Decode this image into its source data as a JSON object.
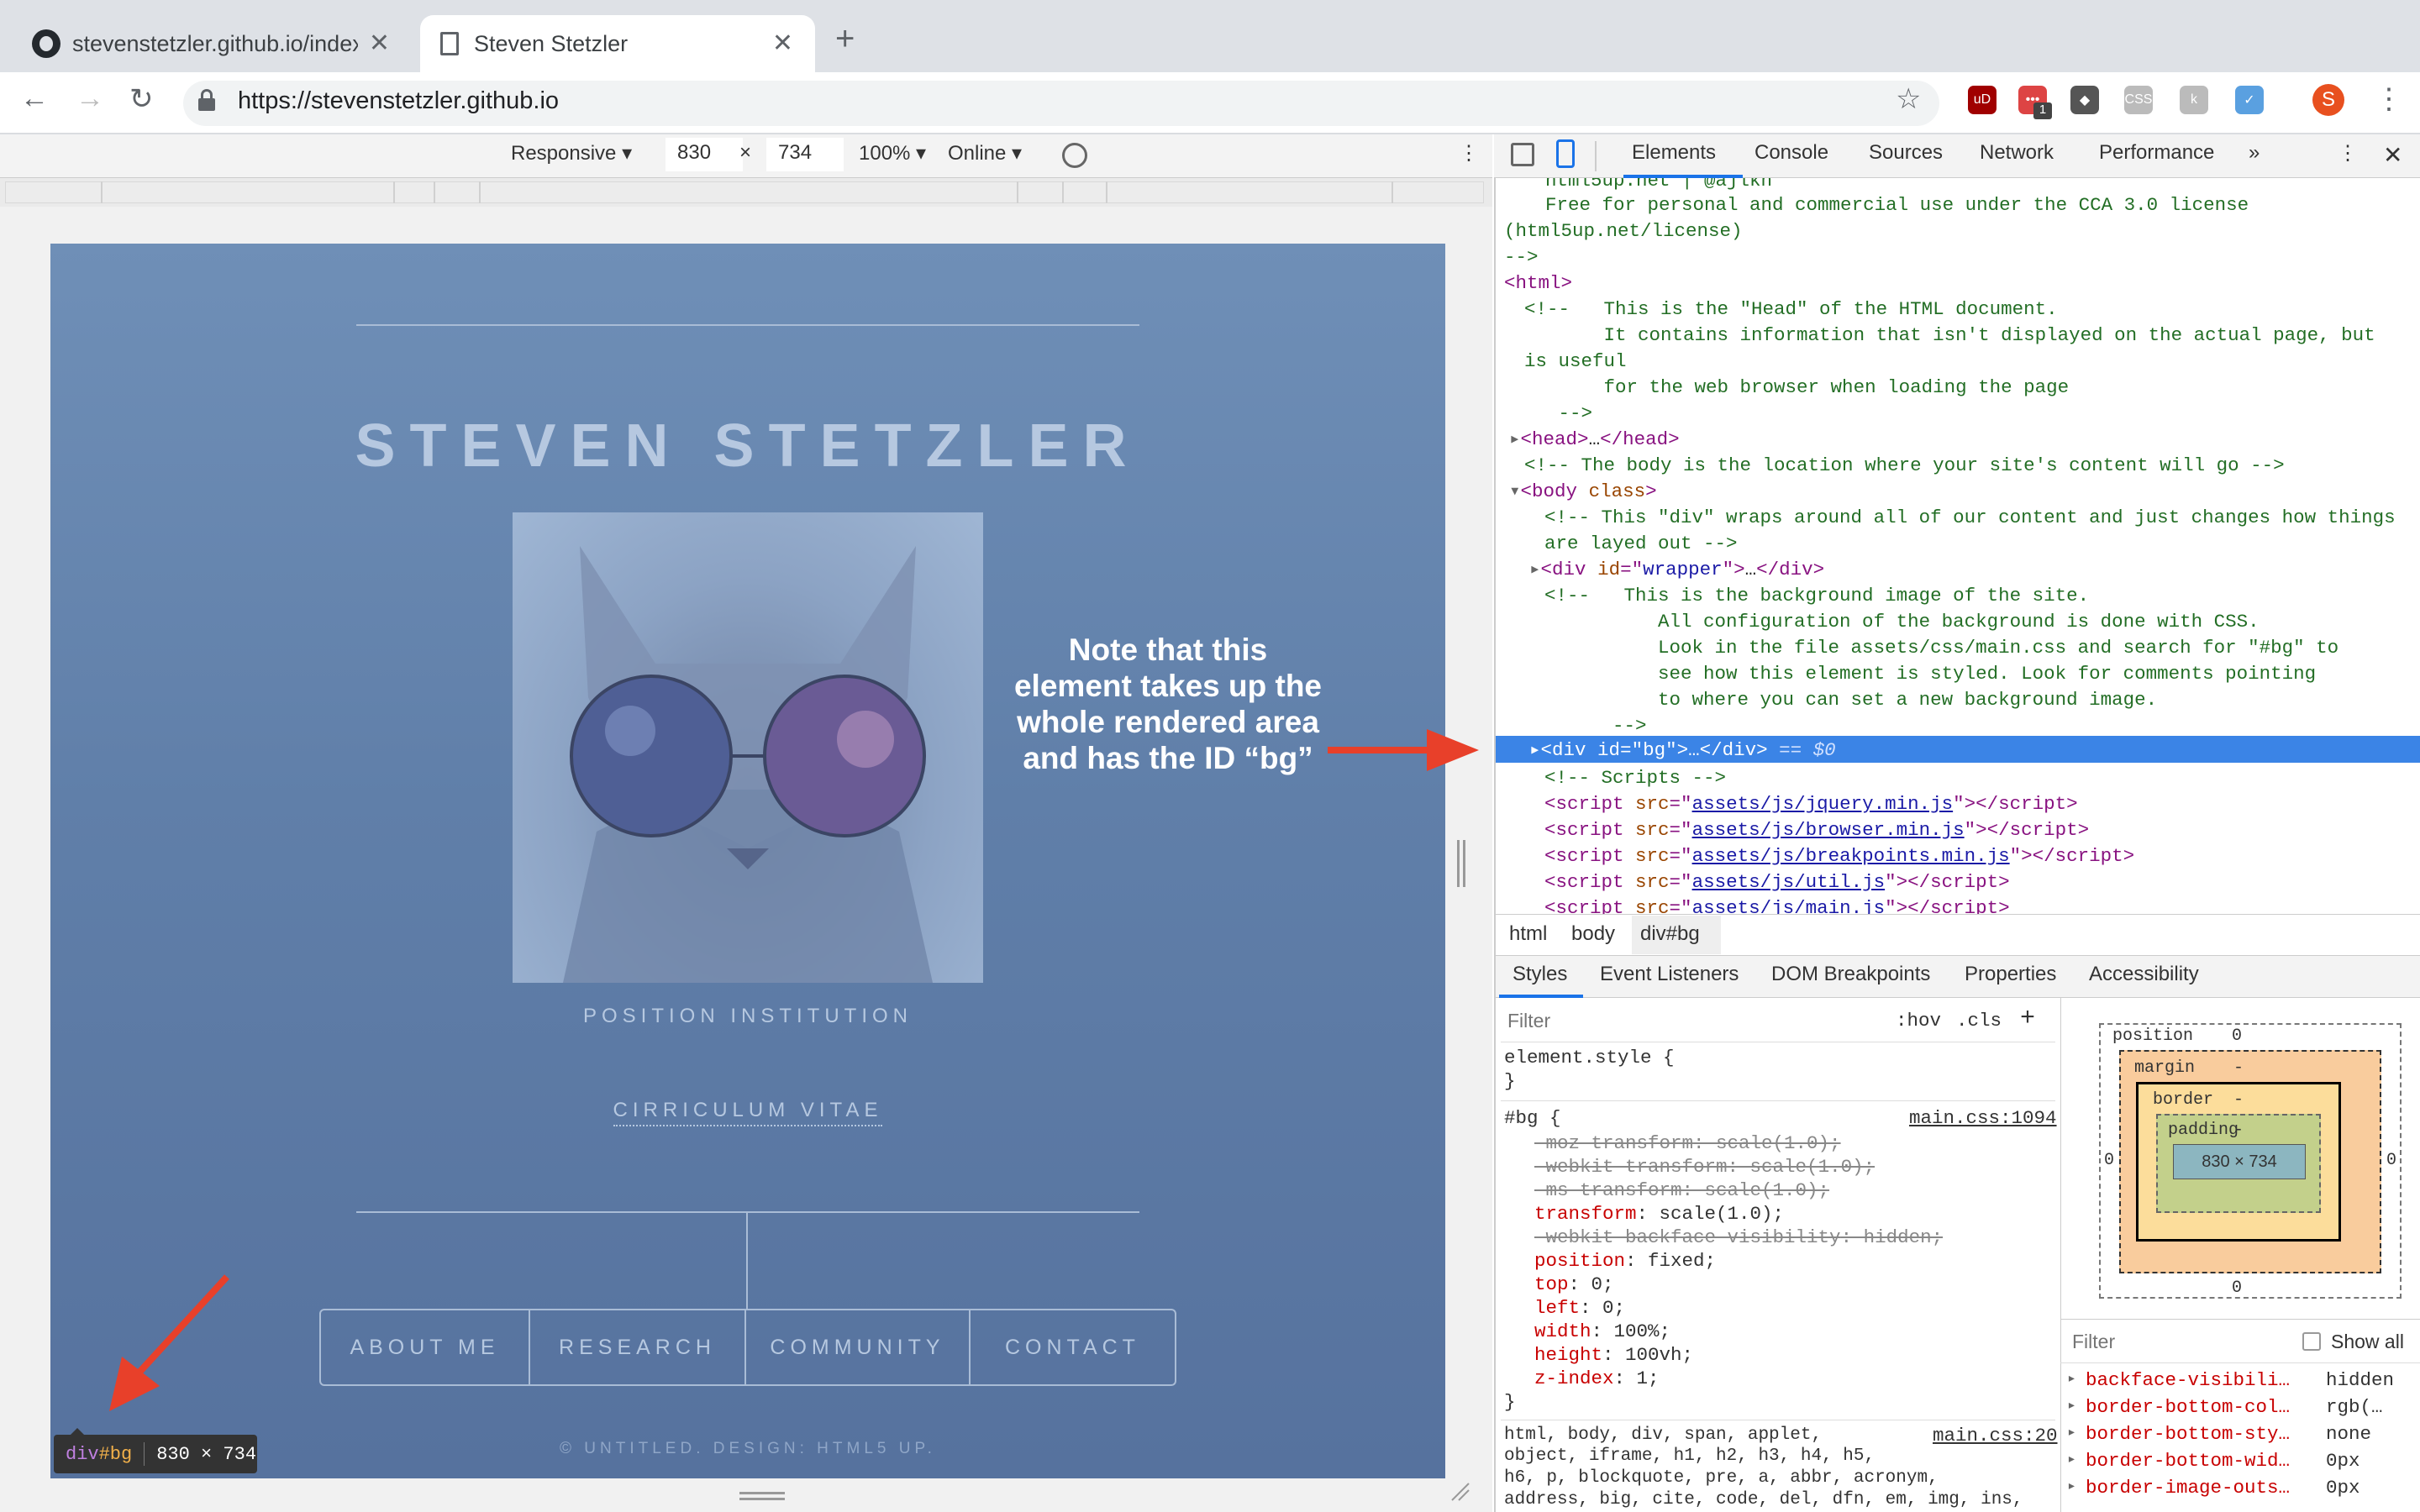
{
  "tabs": [
    {
      "title": "stevenstetzler.github.io/index.h",
      "active": false
    },
    {
      "title": "Steven Stetzler",
      "active": true
    }
  ],
  "address": {
    "url": "https://stevenstetzler.github.io"
  },
  "extensions": [
    {
      "name": "ublock-icon",
      "color": "#a00000",
      "label": "uD"
    },
    {
      "name": "ext-red-icon",
      "color": "#d44",
      "label": "•••",
      "badge": "1"
    },
    {
      "name": "ext-shield-icon",
      "color": "#555",
      "label": "◆"
    },
    {
      "name": "ext-css-icon",
      "color": "#bbb",
      "label": "CSS"
    },
    {
      "name": "ext-grey-icon",
      "color": "#bbb",
      "label": "k"
    },
    {
      "name": "ext-blue-icon",
      "color": "#5aa0e0",
      "label": "✓"
    }
  ],
  "profile": {
    "initial": "S",
    "color": "#e8501f"
  },
  "device_toolbar": {
    "mode": "Responsive ▾",
    "width": "830",
    "times": "×",
    "height": "734",
    "zoom": "100% ▾",
    "network": "Online ▾"
  },
  "site": {
    "title": "STEVEN STETZLER",
    "subtitle": "POSITION INSTITUTION",
    "cv": "CIRRICULUM VITAE",
    "nav": [
      "ABOUT ME",
      "RESEARCH",
      "COMMUNITY",
      "CONTACT"
    ],
    "footer": "© UNTITLED. DESIGN: HTML5 UP."
  },
  "annotation": {
    "note_lines": [
      "Note that this",
      "element takes up the",
      "whole rendered area",
      "and has the ID “bg”"
    ]
  },
  "badge": {
    "tag": "div",
    "id": "#bg",
    "size": "830 × 734"
  },
  "devtools": {
    "tabs": [
      "Elements",
      "Console",
      "Sources",
      "Network",
      "Performance",
      "»"
    ],
    "breadcrumbs": [
      "html",
      "body",
      "div#bg"
    ],
    "subtabs": [
      "Styles",
      "Event Listeners",
      "DOM Breakpoints",
      "Properties",
      "Accessibility"
    ],
    "filter_placeholder": "Filter",
    "hov": ":hov",
    "cls": ".cls",
    "element_style": "element.style {",
    "close_brace": "}",
    "rule_selector": "#bg {",
    "rule_source": "main.css:1094",
    "rule_props": [
      {
        "text": "-moz-transform: scale(1.0);",
        "struck": true
      },
      {
        "text": "-webkit-transform: scale(1.0);",
        "struck": true
      },
      {
        "text": "-ms-transform: scale(1.0);",
        "struck": true
      },
      {
        "text": "transform: scale(1.0);",
        "struck": false
      },
      {
        "text": "-webkit-backface-visibility: hidden;",
        "struck": true
      },
      {
        "text": "position: fixed;",
        "struck": false
      },
      {
        "text": "top: 0;",
        "struck": false
      },
      {
        "text": "left: 0;",
        "struck": false
      },
      {
        "text": "width: 100%;",
        "struck": false
      },
      {
        "text": "height: 100vh;",
        "struck": false
      },
      {
        "text": "z-index: 1;",
        "struck": false
      }
    ],
    "reset_lines": [
      "html, body, div, span, applet,",
      "object, iframe, h1, h2, h3, h4, h5,",
      "h6, p, blockquote, pre, a, abbr, acronym,",
      "address, big, cite, code, del, dfn, em, img, ins,"
    ],
    "reset_source": "main.css:20",
    "boxmodel": {
      "position": "position",
      "position_val": "0",
      "margin": "margin",
      "margin_val": "-",
      "border": "border",
      "border_val": "-",
      "padding": "padding",
      "padding_val": "-",
      "content": "830 × 734",
      "side_zero": "0"
    },
    "computed_filter": "Filter",
    "show_all": "Show all",
    "computed": [
      {
        "prop": "backface-visibili…",
        "val": "hidden"
      },
      {
        "prop": "border-bottom-col…",
        "val": "rgb(…"
      },
      {
        "prop": "border-bottom-sty…",
        "val": "none"
      },
      {
        "prop": "border-bottom-wid…",
        "val": "0px"
      },
      {
        "prop": "border-image-outs…",
        "val": "0px"
      }
    ],
    "selected_suffix": "== $0"
  }
}
